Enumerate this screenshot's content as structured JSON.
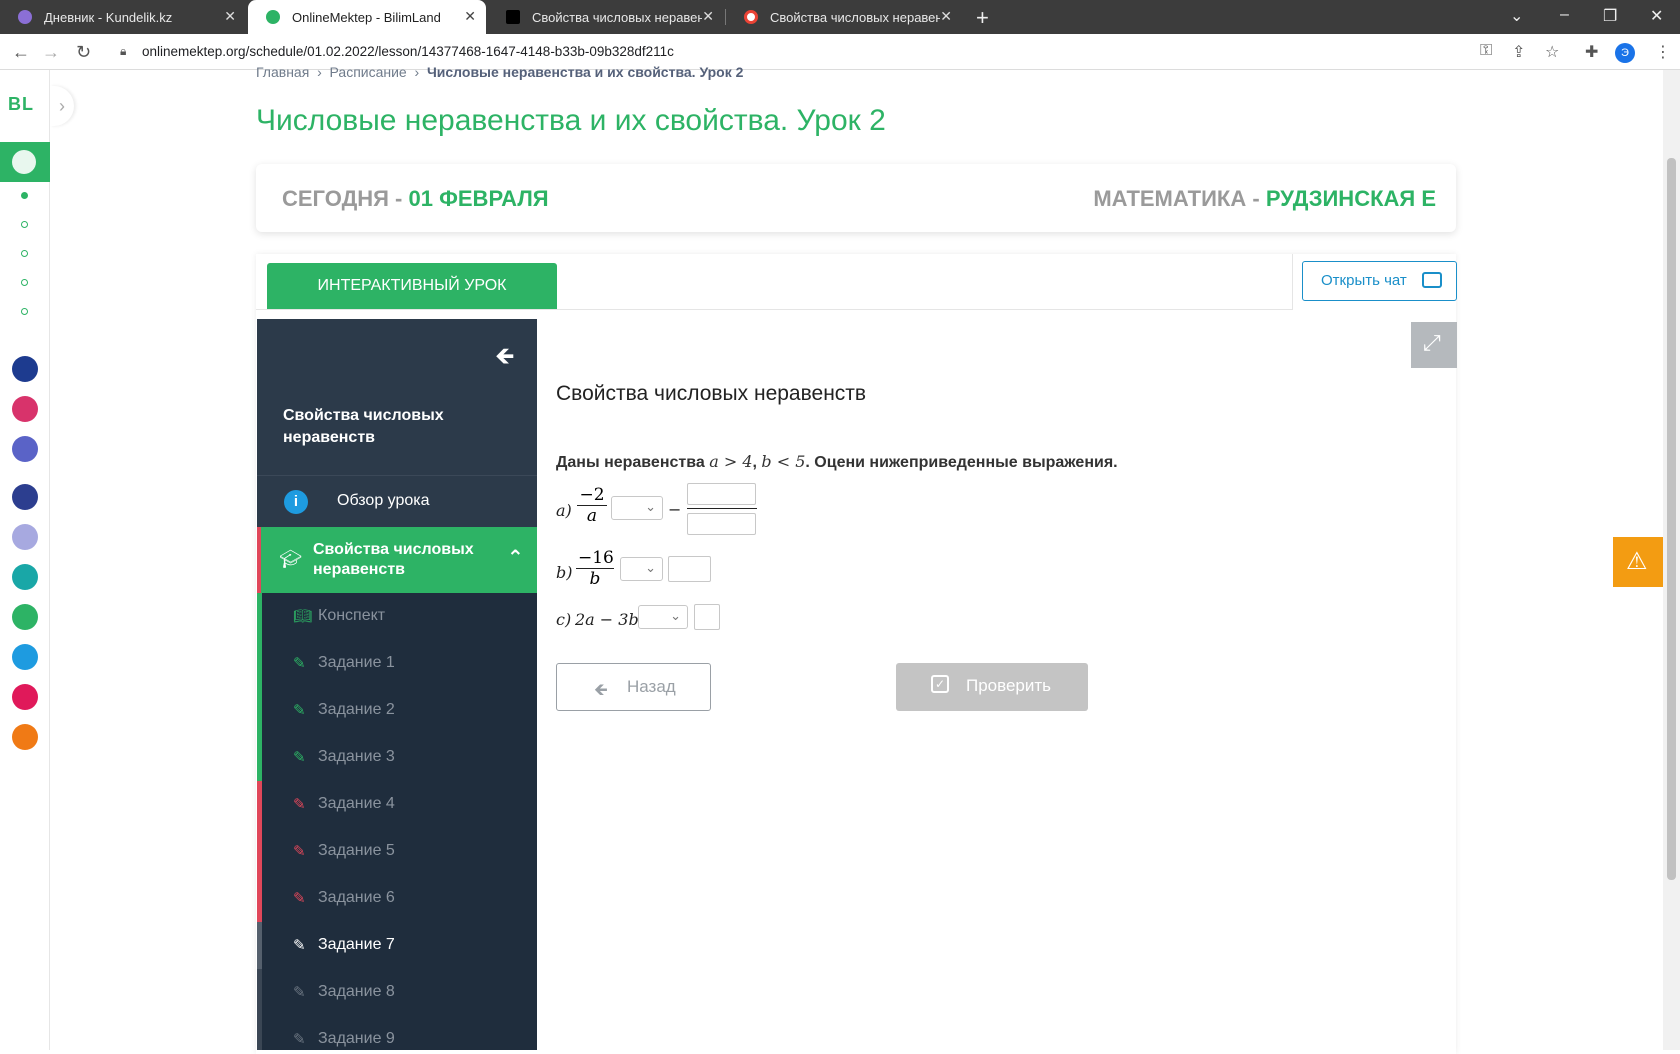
{
  "browser": {
    "tabs": [
      {
        "title": "Дневник - Kundelik.kz"
      },
      {
        "title": "OnlineMektep - BilimLand"
      },
      {
        "title": "Свойства числовых неравенств"
      },
      {
        "title": "Свойства числовых неравенств"
      }
    ],
    "url": "onlinemektep.org/schedule/01.02.2022/lesson/14377468-1647-4148-b33b-09b328df211c",
    "profile_initial": "Э"
  },
  "rail": {
    "logo": "BL"
  },
  "breadcrumb": {
    "home": "Главная",
    "schedule": "Расписание",
    "current": "Числовые неравенства и их свойства. Урок 2"
  },
  "page_title": "Числовые неравенства и их свойства. Урок 2",
  "date_card": {
    "today_label": "СЕГОДНЯ -",
    "today_value": "01 ФЕВРАЛЯ",
    "subject": "МАТЕМАТИКА -",
    "teacher": "РУДЗИНСКАЯ Е"
  },
  "tabs": {
    "interactive": "ИНТЕРАКТИВНЫЙ УРОК",
    "open_chat": "Открыть чат"
  },
  "sidebar": {
    "title": "Свойства числовых неравенств",
    "overview": "Обзор урока",
    "section": "Свойства числовых неравенств",
    "items": [
      {
        "label": "Конспект",
        "status": "done"
      },
      {
        "label": "Задание 1",
        "status": "done"
      },
      {
        "label": "Задание 2",
        "status": "done"
      },
      {
        "label": "Задание 3",
        "status": "done"
      },
      {
        "label": "Задание 4",
        "status": "wrong"
      },
      {
        "label": "Задание 5",
        "status": "wrong"
      },
      {
        "label": "Задание 6",
        "status": "wrong"
      },
      {
        "label": "Задание 7",
        "status": "current"
      },
      {
        "label": "Задание 8",
        "status": "todo"
      },
      {
        "label": "Задание 9",
        "status": "todo"
      }
    ]
  },
  "content": {
    "title": "Свойства числовых неравенств",
    "task_prefix": "Даны неравенства",
    "cond_a": "a > 4",
    "cond_b": "b < 5",
    "task_suffix": ". Оцени нижеприведенные выражения.",
    "row_a": {
      "label": "a)",
      "num": "−2",
      "den": "a",
      "minus": "−"
    },
    "row_b": {
      "label": "b)",
      "num": "−16",
      "den": "b"
    },
    "row_c": {
      "label": "c)",
      "expr": "2a − 3b"
    }
  },
  "buttons": {
    "back": "Назад",
    "check": "Проверить"
  },
  "colors": {
    "brand_green": "#2db365",
    "sidebar_dark": "#1f2d3d",
    "wrong": "#e0475a",
    "warning": "#f39c12"
  }
}
